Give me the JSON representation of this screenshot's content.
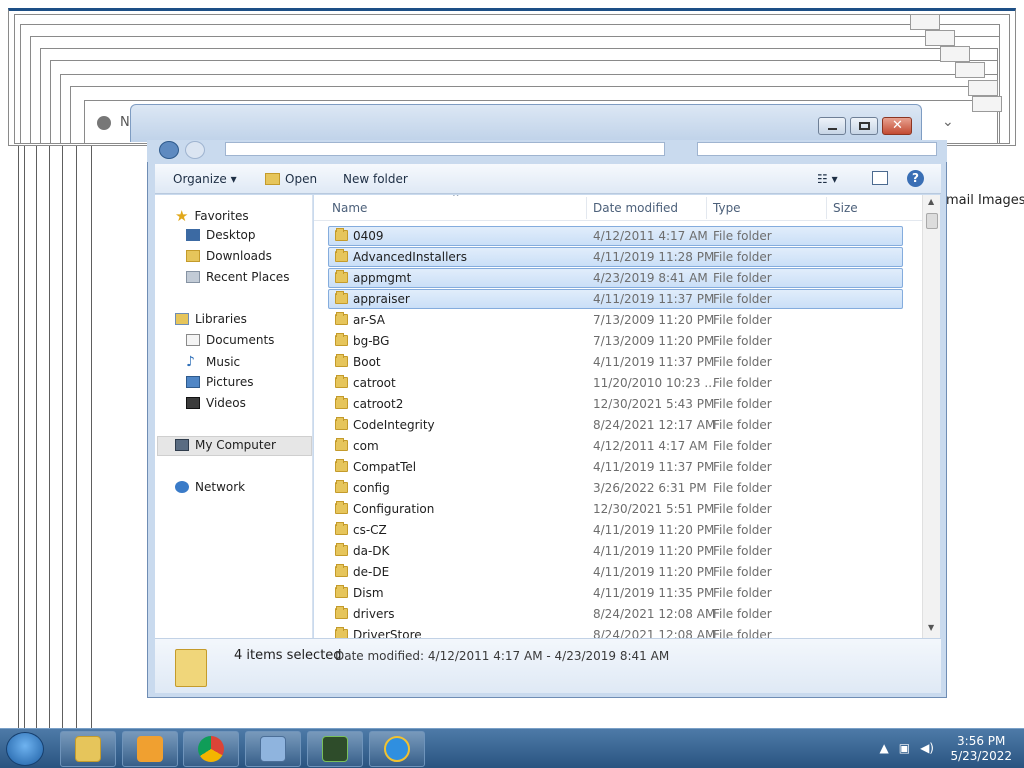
{
  "explorer": {
    "toolbar": {
      "organize": "Organize",
      "open": "Open",
      "new_folder": "New folder"
    },
    "nav": {
      "favorites": "Favorites",
      "desktop": "Desktop",
      "downloads": "Downloads",
      "recent_places": "Recent Places",
      "libraries": "Libraries",
      "documents": "Documents",
      "music": "Music",
      "pictures": "Pictures",
      "videos": "Videos",
      "my_computer": "My Computer",
      "network": "Network"
    },
    "columns": {
      "name": "Name",
      "date_modified": "Date modified",
      "type": "Type",
      "size": "Size"
    },
    "files": [
      {
        "name": "0409",
        "date": "4/12/2011 4:17 AM",
        "type": "File folder"
      },
      {
        "name": "AdvancedInstallers",
        "date": "4/11/2019 11:28 PM",
        "type": "File folder"
      },
      {
        "name": "appmgmt",
        "date": "4/23/2019 8:41 AM",
        "type": "File folder"
      },
      {
        "name": "appraiser",
        "date": "4/11/2019 11:37 PM",
        "type": "File folder"
      },
      {
        "name": "ar-SA",
        "date": "7/13/2009 11:20 PM",
        "type": "File folder"
      },
      {
        "name": "bg-BG",
        "date": "7/13/2009 11:20 PM",
        "type": "File folder"
      },
      {
        "name": "Boot",
        "date": "4/11/2019 11:37 PM",
        "type": "File folder"
      },
      {
        "name": "catroot",
        "date": "11/20/2010 10:23 ...",
        "type": "File folder"
      },
      {
        "name": "catroot2",
        "date": "12/30/2021 5:43 PM",
        "type": "File folder"
      },
      {
        "name": "CodeIntegrity",
        "date": "8/24/2021 12:17 AM",
        "type": "File folder"
      },
      {
        "name": "com",
        "date": "4/12/2011 4:17 AM",
        "type": "File folder"
      },
      {
        "name": "CompatTel",
        "date": "4/11/2019 11:37 PM",
        "type": "File folder"
      },
      {
        "name": "config",
        "date": "3/26/2022 6:31 PM",
        "type": "File folder"
      },
      {
        "name": "Configuration",
        "date": "12/30/2021 5:51 PM",
        "type": "File folder"
      },
      {
        "name": "cs-CZ",
        "date": "4/11/2019 11:20 PM",
        "type": "File folder"
      },
      {
        "name": "da-DK",
        "date": "4/11/2019 11:20 PM",
        "type": "File folder"
      },
      {
        "name": "de-DE",
        "date": "4/11/2019 11:20 PM",
        "type": "File folder"
      },
      {
        "name": "Dism",
        "date": "4/11/2019 11:35 PM",
        "type": "File folder"
      },
      {
        "name": "drivers",
        "date": "8/24/2021 12:08 AM",
        "type": "File folder"
      },
      {
        "name": "DriverStore",
        "date": "8/24/2021 12:08 AM",
        "type": "File folder"
      }
    ],
    "selected_count": 4,
    "details": {
      "count_label": "4 items selected",
      "date_range": "Date modified:  4/12/2011 4:17 AM - 4/23/2019 8:41 AM"
    }
  },
  "browser_bg": {
    "tab_letter": "N",
    "link_mail": "mail",
    "link_images": "Images"
  },
  "taskbar": {
    "time": "3:56 PM",
    "date": "5/23/2022"
  },
  "colors": {
    "selection": "#cadff7",
    "taskbar": "#2a5480",
    "folder": "#e6c55b"
  }
}
